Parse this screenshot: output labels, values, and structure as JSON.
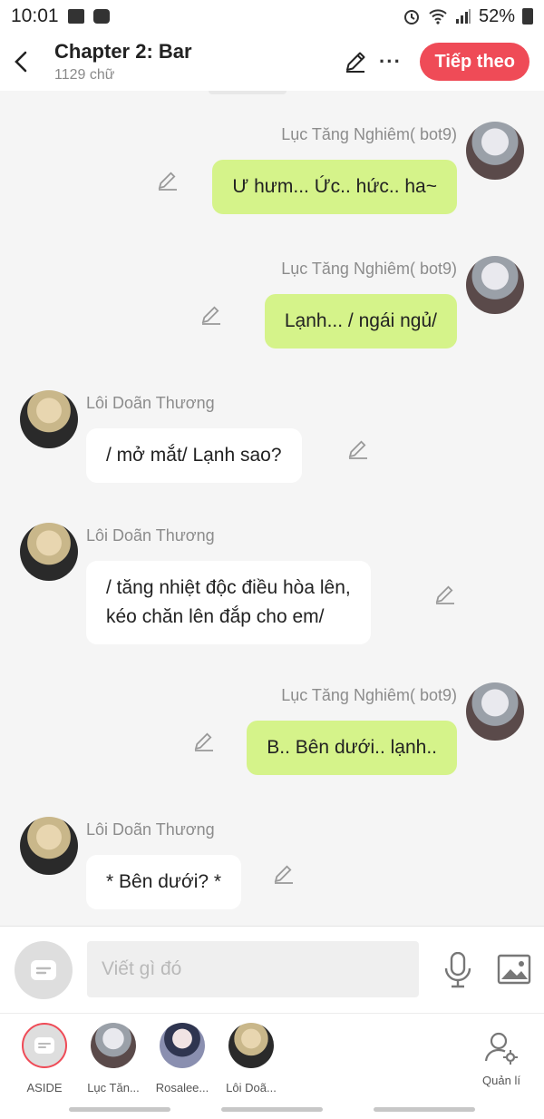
{
  "status_bar": {
    "time": "10:01",
    "battery": "52%"
  },
  "header": {
    "title": "Chapter 2: Bar",
    "subtitle": "1129 chữ",
    "next_label": "Tiếp theo"
  },
  "characters": {
    "luc": "Lục Tăng Nghiêm( bot9)",
    "loi": "Lôi Doãn Thương"
  },
  "messages": [
    {
      "sender": "Lục Tăng Nghiêm( bot9)",
      "side": "right",
      "text": "Ư hưm... Ức.. hức.. ha~"
    },
    {
      "sender": "Lục Tăng Nghiêm( bot9)",
      "side": "right",
      "text": "Lạnh... / ngái ngủ/"
    },
    {
      "sender": "Lôi Doãn Thương",
      "side": "left",
      "text": "/ mở mắt/ Lạnh sao?"
    },
    {
      "sender": "Lôi Doãn Thương",
      "side": "left",
      "text_lines": [
        "/ tăng nhiệt độc điều hòa lên,",
        "kéo chăn lên đắp cho em/"
      ]
    },
    {
      "sender": "Lục Tăng Nghiêm( bot9)",
      "side": "right",
      "text": "B.. Bên dưới.. lạnh.."
    },
    {
      "sender": "Lôi Doãn Thương",
      "side": "left",
      "text": "* Bên dưới? *"
    }
  ],
  "composer": {
    "placeholder": "Viết gì đó"
  },
  "character_bar": {
    "items": [
      {
        "label": "ASIDE"
      },
      {
        "label": "Lục Tăn..."
      },
      {
        "label": "Rosalee..."
      },
      {
        "label": "Lôi Doã..."
      }
    ],
    "manage_label": "Quản lí"
  },
  "colors": {
    "accent": "#ef4b57",
    "bubble_self": "#d5f38a",
    "bubble_other": "#ffffff",
    "background": "#f5f5f5"
  }
}
